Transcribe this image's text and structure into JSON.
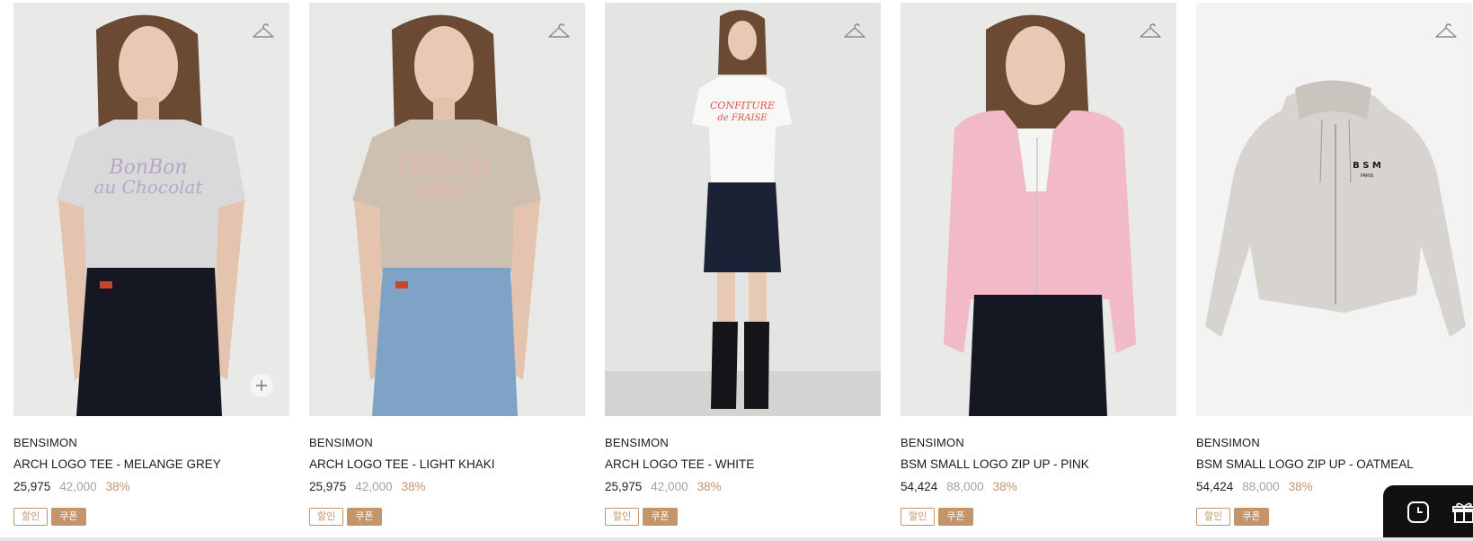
{
  "colors": {
    "accent": "#c4956b",
    "sale_price": "#222222",
    "original_price": "#a3a3a3"
  },
  "products": [
    {
      "brand": "BENSIMON",
      "name": "ARCH LOGO TEE - MELANGE GREY",
      "sale_price": "25,975",
      "original_price": "42,000",
      "discount": "38%",
      "badges": [
        "할인",
        "쿠폰"
      ],
      "shirt_text": [
        "BonBon",
        "au Chocolat"
      ]
    },
    {
      "brand": "BENSIMON",
      "name": "ARCH LOGO TEE - LIGHT KHAKI",
      "sale_price": "25,975",
      "original_price": "42,000",
      "discount": "38%",
      "badges": [
        "할인",
        "쿠폰"
      ],
      "shirt_text": [
        "FRENCH",
        "TOAST"
      ]
    },
    {
      "brand": "BENSIMON",
      "name": "ARCH LOGO TEE - WHITE",
      "sale_price": "25,975",
      "original_price": "42,000",
      "discount": "38%",
      "badges": [
        "할인",
        "쿠폰"
      ],
      "shirt_text": [
        "CONFITURE",
        "de FRAISE"
      ]
    },
    {
      "brand": "BENSIMON",
      "name": "BSM SMALL LOGO ZIP UP - PINK",
      "sale_price": "54,424",
      "original_price": "88,000",
      "discount": "38%",
      "badges": [
        "할인",
        "쿠폰"
      ]
    },
    {
      "brand": "BENSIMON",
      "name": "BSM SMALL LOGO ZIP UP - OATMEAL",
      "sale_price": "54,424",
      "original_price": "88,000",
      "discount": "38%",
      "badges": [
        "할인",
        "쿠폰"
      ],
      "hoodie_logo": [
        "B S M",
        "PARIS"
      ]
    }
  ],
  "icons": {
    "wishlist": "hanger-icon",
    "quick_add": "plus-icon",
    "recent": "clock-icon",
    "gift": "gift-icon"
  }
}
